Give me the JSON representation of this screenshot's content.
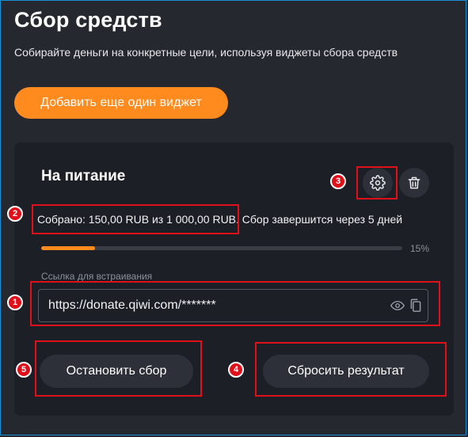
{
  "page": {
    "title": "Сбор средств",
    "subtitle": "Собирайте деньги на конкретные цели, используя виджеты сбора средств",
    "add_widget_label": "Добавить еще один виджет"
  },
  "widget": {
    "title": "На питание",
    "collected_text": "Собрано: 150,00 RUB из 1 000,00 RUB.",
    "ends_text": "Сбор завершится через 5 дней",
    "progress_label": "15%",
    "progress_fraction": 0.15,
    "embed_label": "Ссылка для встраивания",
    "embed_value": "https://donate.qiwi.com/*******",
    "stop_label": "Остановить сбор",
    "reset_label": "Сбросить результат"
  },
  "icons": {
    "settings": "gear-icon",
    "delete": "trash-icon",
    "show": "eye-icon",
    "copy": "copy-icon"
  },
  "annotations": {
    "embed_badge": "1",
    "status_badge": "2",
    "settings_badge": "3",
    "reset_badge": "4",
    "stop_badge": "5"
  },
  "colors": {
    "accent": "#ff8a1e",
    "background": "#25282f",
    "card": "#1c1f25",
    "highlight": "#e0101b"
  }
}
